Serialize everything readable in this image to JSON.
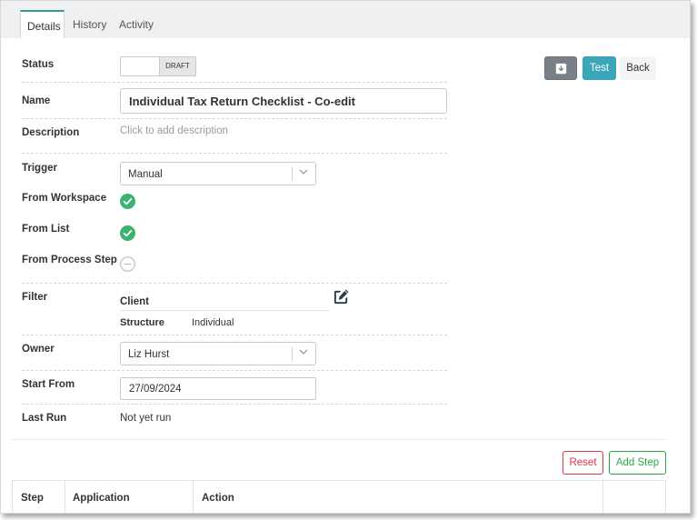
{
  "tabs": [
    {
      "label": "Details",
      "active": true
    },
    {
      "label": "History",
      "active": false
    },
    {
      "label": "Activity",
      "active": false
    }
  ],
  "fields": {
    "status": {
      "label": "Status",
      "toggle_state": "DRAFT"
    },
    "name": {
      "label": "Name",
      "value": "Individual Tax Return Checklist - Co-edit"
    },
    "description": {
      "label": "Description",
      "placeholder": "Click to add description"
    },
    "trigger": {
      "label": "Trigger",
      "value": "Manual"
    },
    "from_workspace": {
      "label": "From Workspace",
      "checked": true
    },
    "from_list": {
      "label": "From List",
      "checked": true
    },
    "from_process_step": {
      "label": "From Process Step",
      "checked": false
    },
    "filter": {
      "label": "Filter",
      "entity": "Client",
      "structure_label": "Structure",
      "structure_value": "Individual"
    },
    "owner": {
      "label": "Owner",
      "value": "Liz Hurst"
    },
    "start_from": {
      "label": "Start From",
      "value": "27/09/2024"
    },
    "last_run": {
      "label": "Last Run",
      "value": "Not yet run"
    }
  },
  "actions": {
    "archive_icon": "archive-box-icon",
    "test_label": "Test",
    "back_label": "Back",
    "reset_label": "Reset",
    "add_step_label": "Add Step"
  },
  "steps_table": {
    "columns": [
      "Step",
      "Application",
      "Action",
      ""
    ]
  },
  "colors": {
    "accent_tab": "#2f9e91",
    "check_green": "#3cb371",
    "test_button": "#3aa6b9",
    "reset_red": "#dc3545",
    "add_step_green": "#28a745",
    "archive_gray": "#7a8088"
  }
}
